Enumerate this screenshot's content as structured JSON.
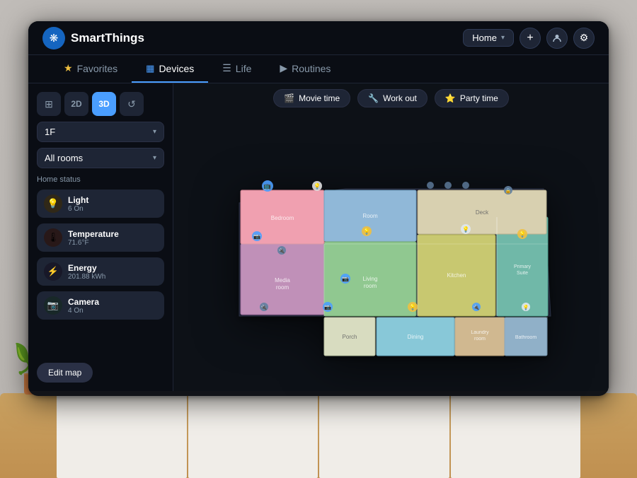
{
  "app": {
    "name": "SmartThings",
    "logo_symbol": "❋"
  },
  "header": {
    "home_selector": {
      "label": "Home",
      "dropdown_icon": "▾"
    },
    "add_icon": "+",
    "profile_icon": "👤",
    "settings_icon": "⚙"
  },
  "nav": {
    "tabs": [
      {
        "id": "favorites",
        "label": "Favorites",
        "icon": "★",
        "active": false
      },
      {
        "id": "devices",
        "label": "Devices",
        "icon": "▦",
        "active": true
      },
      {
        "id": "life",
        "label": "Life",
        "icon": "☰",
        "active": false
      },
      {
        "id": "routines",
        "label": "Routines",
        "icon": "▶",
        "active": false
      }
    ]
  },
  "sidebar": {
    "view_controls": [
      {
        "id": "grid",
        "label": "⊞",
        "active": false
      },
      {
        "id": "2d",
        "label": "2D",
        "active": false
      },
      {
        "id": "3d",
        "label": "3D",
        "active": true
      },
      {
        "id": "history",
        "label": "↺",
        "active": false
      }
    ],
    "floor_selector": {
      "value": "1F",
      "dropdown_icon": "▾"
    },
    "room_selector": {
      "value": "All rooms",
      "dropdown_icon": "▾"
    },
    "home_status_title": "Home status",
    "status_items": [
      {
        "id": "light",
        "label": "Light",
        "value": "6 On",
        "icon": "💡",
        "type": "light"
      },
      {
        "id": "temperature",
        "label": "Temperature",
        "value": "71.6°F",
        "icon": "🌡",
        "type": "temp"
      },
      {
        "id": "energy",
        "label": "Energy",
        "value": "201.88 kWh",
        "icon": "⚡",
        "type": "energy"
      },
      {
        "id": "camera",
        "label": "Camera",
        "value": "4 On",
        "icon": "📷",
        "type": "camera"
      }
    ],
    "edit_map_label": "Edit map"
  },
  "scene_bar": {
    "scenes": [
      {
        "id": "movie-time",
        "label": "Movie time",
        "icon": "🎬"
      },
      {
        "id": "work-out",
        "label": "Work out",
        "icon": "🔧"
      },
      {
        "id": "party-time",
        "label": "Party time",
        "icon": "⭐"
      }
    ]
  },
  "floor_plan": {
    "rooms": [
      {
        "name": "Media room",
        "color": "#c0a0c0"
      },
      {
        "name": "Living room",
        "color": "#a0c8a0"
      },
      {
        "name": "Kitchen",
        "color": "#c0c080"
      },
      {
        "name": "Primary Suite",
        "color": "#80c0b0"
      },
      {
        "name": "Bedroom",
        "color": "#f0a0b0"
      },
      {
        "name": "Porch",
        "color": "#d0d8c0"
      },
      {
        "name": "Dining",
        "color": "#90c8d8"
      },
      {
        "name": "Laundry room",
        "color": "#d8c0a0"
      },
      {
        "name": "Bathroom",
        "color": "#a0b8d0"
      },
      {
        "name": "Deck",
        "color": "#e0d8c0"
      }
    ]
  },
  "colors": {
    "bg_primary": "#0d1117",
    "bg_secondary": "#1e2535",
    "accent_blue": "#4a9eff",
    "text_primary": "#ffffff",
    "text_secondary": "#8899aa"
  }
}
